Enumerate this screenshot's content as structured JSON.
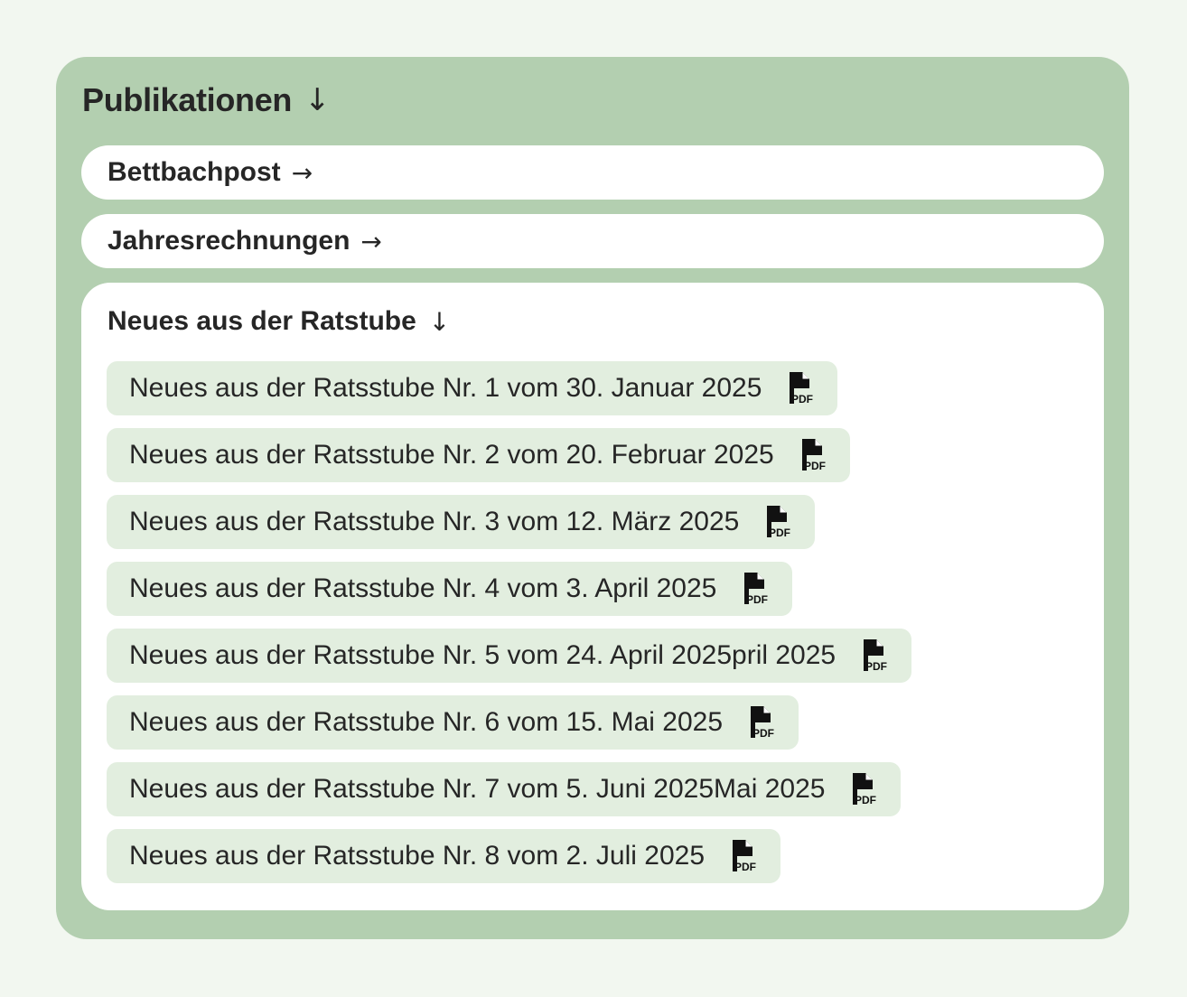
{
  "publications": {
    "title": "Publikationen",
    "title_icon": "arrow-down-icon",
    "sections": [
      {
        "label": "Bettbachpost",
        "icon": "arrow-right-icon",
        "state": "collapsed"
      },
      {
        "label": "Jahresrechnungen",
        "icon": "arrow-right-icon",
        "state": "collapsed"
      }
    ],
    "expanded_section": {
      "title": "Neues aus der Ratstube",
      "icon": "arrow-down-icon",
      "state": "expanded",
      "documents": [
        {
          "label": "Neues aus der Ratsstube Nr. 1 vom 30. Januar 2025",
          "icon": "pdf-file-icon"
        },
        {
          "label": "Neues aus der Ratsstube Nr. 2 vom 20. Februar 2025",
          "icon": "pdf-file-icon"
        },
        {
          "label": "Neues aus der Ratsstube Nr. 3 vom 12. März 2025",
          "icon": "pdf-file-icon"
        },
        {
          "label": "Neues aus der Ratsstube Nr. 4 vom 3. April 2025",
          "icon": "pdf-file-icon"
        },
        {
          "label": "Neues aus der Ratsstube Nr. 5 vom 24. April 2025pril 2025",
          "icon": "pdf-file-icon"
        },
        {
          "label": "Neues aus der Ratsstube Nr. 6 vom 15. Mai 2025",
          "icon": "pdf-file-icon"
        },
        {
          "label": "Neues aus der Ratsstube Nr. 7 vom 5. Juni 2025Mai 2025",
          "icon": "pdf-file-icon"
        },
        {
          "label": "Neues aus der Ratsstube Nr. 8 vom 2. Juli 2025",
          "icon": "pdf-file-icon"
        }
      ]
    }
  },
  "colors": {
    "page_background": "#f2f7f0",
    "panel_background": "#b3cfb0",
    "card_background": "#ffffff",
    "document_background": "#e2eedf",
    "text": "#262626"
  }
}
